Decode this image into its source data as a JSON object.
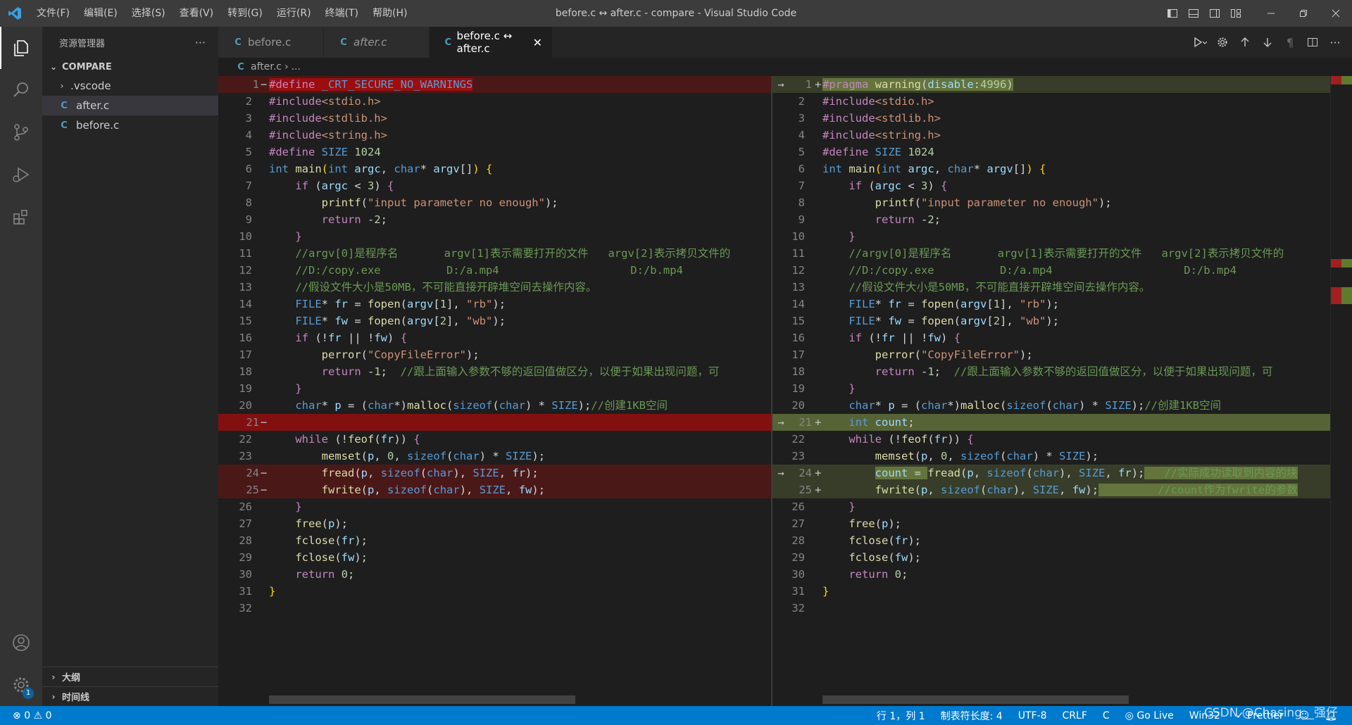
{
  "window": {
    "title": "before.c ↔ after.c - compare - Visual Studio Code",
    "menu": [
      "文件(F)",
      "编辑(E)",
      "选择(S)",
      "查看(V)",
      "转到(G)",
      "运行(R)",
      "终端(T)",
      "帮助(H)"
    ]
  },
  "sidebar": {
    "header": "资源管理器",
    "more": "···",
    "section": "COMPARE",
    "items": [
      {
        "label": ".vscode",
        "type": "folder"
      },
      {
        "label": "after.c",
        "type": "file",
        "icon": "C"
      },
      {
        "label": "before.c",
        "type": "file",
        "icon": "C"
      }
    ],
    "bottom_sections": [
      "大纲",
      "时间线"
    ]
  },
  "activity": {
    "settings_badge": "1"
  },
  "tabs": [
    {
      "label": "before.c",
      "icon": "C",
      "italic": false
    },
    {
      "label": "after.c",
      "icon": "C",
      "italic": true
    },
    {
      "label": "before.c ↔ after.c",
      "icon": "C",
      "active": true,
      "close": "✕"
    }
  ],
  "breadcrumb": {
    "icon": "C",
    "file": "after.c",
    "sep": "›",
    "more": "..."
  },
  "diff": {
    "left_removed_lines": [
      1,
      21,
      24,
      25
    ],
    "right_added_lines": [
      1,
      21,
      24,
      25
    ],
    "colors": {
      "removed": "#ff0000",
      "added": "#9bb955"
    }
  },
  "statusbar": {
    "errors": "0",
    "warnings": "0",
    "position": "行 1，列 1",
    "tab_size": "制表符长度: 4",
    "encoding": "UTF-8",
    "eol": "CRLF",
    "language": "C",
    "golive": "Go Live",
    "platform": "Win32",
    "prettier": "Prettier"
  },
  "watermark": "CSDN @Chasing__强仔"
}
